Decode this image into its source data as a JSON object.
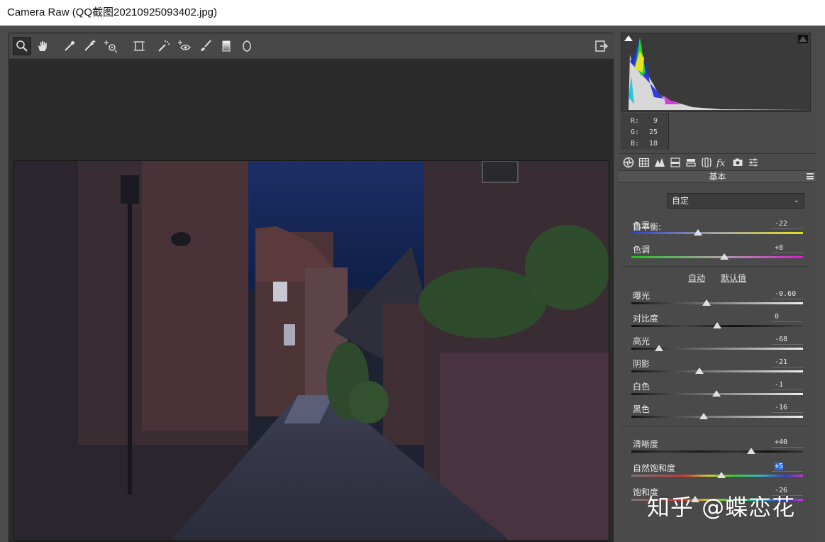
{
  "window": {
    "title": "Camera Raw (QQ截图20210925093402.jpg)"
  },
  "toolbar": {
    "tools": [
      {
        "name": "zoom-tool",
        "icon": "magnifier-icon"
      },
      {
        "name": "hand-tool",
        "icon": "hand-icon"
      },
      {
        "name": "white-balance-tool",
        "icon": "eyedropper-icon"
      },
      {
        "name": "color-sampler-tool",
        "icon": "eyedropper-plus-icon"
      },
      {
        "name": "targeted-adjustment-tool",
        "icon": "target-icon"
      },
      {
        "name": "transform-tool",
        "icon": "transform-icon"
      },
      {
        "name": "spot-removal-tool",
        "icon": "spot-icon"
      },
      {
        "name": "red-eye-tool",
        "icon": "eye-icon"
      },
      {
        "name": "adjustment-brush-tool",
        "icon": "brush-icon"
      },
      {
        "name": "graduated-filter-tool",
        "icon": "gradient-icon"
      },
      {
        "name": "radial-filter-tool",
        "icon": "ellipse-icon"
      }
    ],
    "export_icon": "export-icon"
  },
  "histogram": {
    "readout": [
      {
        "label": "R:",
        "value": "9"
      },
      {
        "label": "G:",
        "value": "25"
      },
      {
        "label": "B:",
        "value": "18"
      }
    ]
  },
  "panel": {
    "title": "基本",
    "white_balance_label": "白平衡:",
    "white_balance_value": "自定",
    "auto_link": "自动",
    "default_link": "默认值",
    "sliders": [
      {
        "key": "temp",
        "label": "色温",
        "value": "-22",
        "level": 0.39
      },
      {
        "key": "tint",
        "label": "色调",
        "value": "+8",
        "level": 0.54
      },
      {
        "key": "exposure",
        "label": "曝光",
        "value": "-0.60",
        "level": 0.44
      },
      {
        "key": "contrast",
        "label": "对比度",
        "value": "0",
        "level": 0.5
      },
      {
        "key": "highlights",
        "label": "高光",
        "value": "-68",
        "level": 0.16
      },
      {
        "key": "shadows",
        "label": "阴影",
        "value": "-21",
        "level": 0.395
      },
      {
        "key": "whites",
        "label": "白色",
        "value": "-1",
        "level": 0.495
      },
      {
        "key": "blacks",
        "label": "黑色",
        "value": "-16",
        "level": 0.42
      },
      {
        "key": "clarity",
        "label": "清晰度",
        "value": "+40",
        "level": 0.7
      },
      {
        "key": "vibrance",
        "label": "自然饱和度",
        "value": "+5",
        "level": 0.525
      },
      {
        "key": "saturation",
        "label": "饱和度",
        "value": "-26",
        "level": 0.37
      }
    ]
  },
  "watermark": "知乎 @蝶恋花",
  "colors": {
    "accent_selection": "#2b6bd6",
    "panel_bg": "#4a4a4a"
  }
}
